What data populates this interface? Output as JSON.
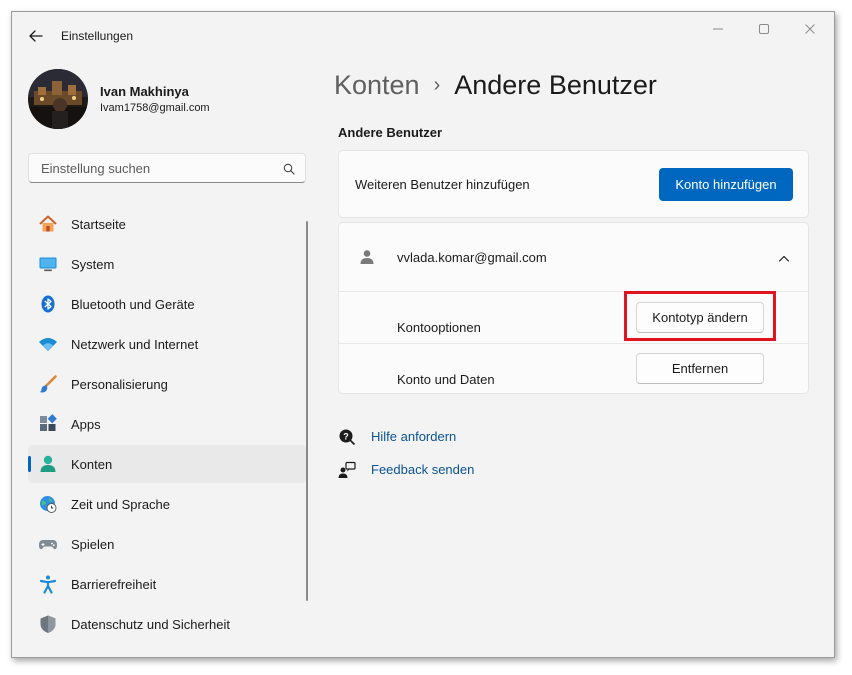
{
  "window": {
    "title": "Einstellungen",
    "controls": [
      "minimize",
      "maximize",
      "close"
    ]
  },
  "profile": {
    "name": "Ivan Makhinya",
    "email": "Ivam1758@gmail.com"
  },
  "search": {
    "placeholder": "Einstellung suchen"
  },
  "sidebar": {
    "items": [
      {
        "label": "Startseite",
        "icon": "home-icon"
      },
      {
        "label": "System",
        "icon": "monitor-icon"
      },
      {
        "label": "Bluetooth und Geräte",
        "icon": "bluetooth-icon"
      },
      {
        "label": "Netzwerk und Internet",
        "icon": "wifi-icon"
      },
      {
        "label": "Personalisierung",
        "icon": "brush-icon"
      },
      {
        "label": "Apps",
        "icon": "apps-icon"
      },
      {
        "label": "Konten",
        "icon": "account-icon",
        "active": true
      },
      {
        "label": "Zeit und Sprache",
        "icon": "globe-clock-icon"
      },
      {
        "label": "Spielen",
        "icon": "gamepad-icon"
      },
      {
        "label": "Barrierefreiheit",
        "icon": "accessibility-icon"
      },
      {
        "label": "Datenschutz und Sicherheit",
        "icon": "shield-icon"
      }
    ]
  },
  "breadcrumb": {
    "parent": "Konten",
    "separator": "›",
    "current": "Andere Benutzer"
  },
  "main": {
    "section_title": "Andere Benutzer",
    "add_user": {
      "label": "Weiteren Benutzer hinzufügen",
      "button": "Konto hinzufügen"
    },
    "account": {
      "email": "vvlada.komar@gmail.com",
      "options_label": "Kontooptionen",
      "change_type_button": "Kontotyp ändern",
      "data_label": "Konto und Daten",
      "remove_button": "Entfernen"
    },
    "links": {
      "help": "Hilfe anfordern",
      "feedback": "Feedback senden"
    }
  },
  "colors": {
    "accent": "#0067c0",
    "highlight": "#e0141e",
    "window_bg": "#f3f3f3",
    "card_bg": "#fbfbfb"
  }
}
